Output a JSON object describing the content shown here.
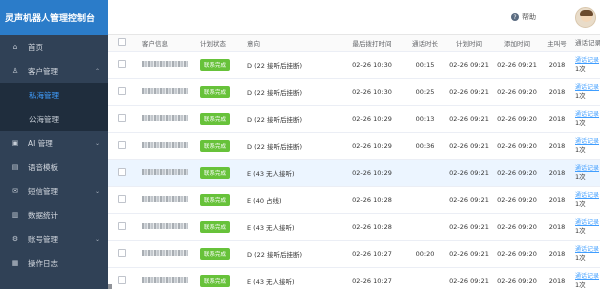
{
  "app": {
    "title": "灵声机器人管理控制台"
  },
  "header": {
    "help_label": "帮助"
  },
  "sidebar": {
    "items": [
      {
        "label": "首页",
        "icon": "home-icon",
        "glyph": "⌂"
      },
      {
        "label": "客户管理",
        "icon": "user-icon",
        "glyph": "♙",
        "expanded": true,
        "children": [
          {
            "label": "私海管理",
            "active": true
          },
          {
            "label": "公海管理",
            "active": false
          }
        ]
      },
      {
        "label": "AI 管理",
        "icon": "ai-icon",
        "glyph": "▣",
        "arrow": "⌄"
      },
      {
        "label": "语音模板",
        "icon": "voice-icon",
        "glyph": "▤"
      },
      {
        "label": "短信管理",
        "icon": "sms-icon",
        "glyph": "✉",
        "arrow": "⌄"
      },
      {
        "label": "数据统计",
        "icon": "chart-icon",
        "glyph": "▥"
      },
      {
        "label": "账号管理",
        "icon": "account-icon",
        "glyph": "⚙",
        "arrow": "⌄"
      },
      {
        "label": "操作日志",
        "icon": "log-icon",
        "glyph": "▦"
      }
    ]
  },
  "table": {
    "headers": {
      "customer": "客户信息",
      "plan": "计划状态",
      "intent": "意向",
      "last_call": "最后拨打时间",
      "duration": "通话时长",
      "plan_time": "计划时间",
      "add_time": "添加时间",
      "host": "主叫号",
      "record": "通话记录"
    },
    "rows": [
      {
        "plan": "联系完成",
        "intent": "D (22 接听后挂断)",
        "last": "02-26 10:30",
        "dur": "00:15",
        "ptime": "02-26 09:21",
        "add": "02-26 09:21",
        "host": "2018",
        "rec": "通话记录",
        "count": "1次"
      },
      {
        "plan": "联系完成",
        "intent": "D (22 接听后挂断)",
        "last": "02-26 10:30",
        "dur": "00:25",
        "ptime": "02-26 09:21",
        "add": "02-26 09:20",
        "host": "2018",
        "rec": "通话记录",
        "count": "1次"
      },
      {
        "plan": "联系完成",
        "intent": "D (22 接听后挂断)",
        "last": "02-26 10:29",
        "dur": "00:13",
        "ptime": "02-26 09:21",
        "add": "02-26 09:20",
        "host": "2018",
        "rec": "通话记录",
        "count": "1次"
      },
      {
        "plan": "联系完成",
        "intent": "D (22 接听后挂断)",
        "last": "02-26 10:29",
        "dur": "00:36",
        "ptime": "02-26 09:21",
        "add": "02-26 09:20",
        "host": "2018",
        "rec": "通话记录",
        "count": "1次"
      },
      {
        "plan": "联系完成",
        "intent": "E (43 无人接听)",
        "last": "02-26 10:29",
        "dur": "",
        "ptime": "02-26 09:21",
        "add": "02-26 09:20",
        "host": "2018",
        "rec": "通话记录",
        "count": "1次"
      },
      {
        "plan": "联系完成",
        "intent": "E (40 占线)",
        "last": "02-26 10:28",
        "dur": "",
        "ptime": "02-26 09:21",
        "add": "02-26 09:20",
        "host": "2018",
        "rec": "通话记录",
        "count": "1次"
      },
      {
        "plan": "联系完成",
        "intent": "E (43 无人接听)",
        "last": "02-26 10:28",
        "dur": "",
        "ptime": "02-26 09:21",
        "add": "02-26 09:20",
        "host": "2018",
        "rec": "通话记录",
        "count": "1次"
      },
      {
        "plan": "联系完成",
        "intent": "D (22 接听后挂断)",
        "last": "02-26 10:27",
        "dur": "00:20",
        "ptime": "02-26 09:21",
        "add": "02-26 09:20",
        "host": "2018",
        "rec": "通话记录",
        "count": "1次"
      },
      {
        "plan": "联系完成",
        "intent": "E (43 无人接听)",
        "last": "02-26 10:27",
        "dur": "",
        "ptime": "02-26 09:21",
        "add": "02-26 09:20",
        "host": "2018",
        "rec": "通话记录",
        "count": "1次"
      }
    ]
  },
  "colors": {
    "sidebar_bg": "#304156",
    "brand_bg": "#2b7cc9",
    "accent": "#409eff",
    "badge_green": "#67c23a",
    "row_highlight": "#ecf5ff"
  }
}
